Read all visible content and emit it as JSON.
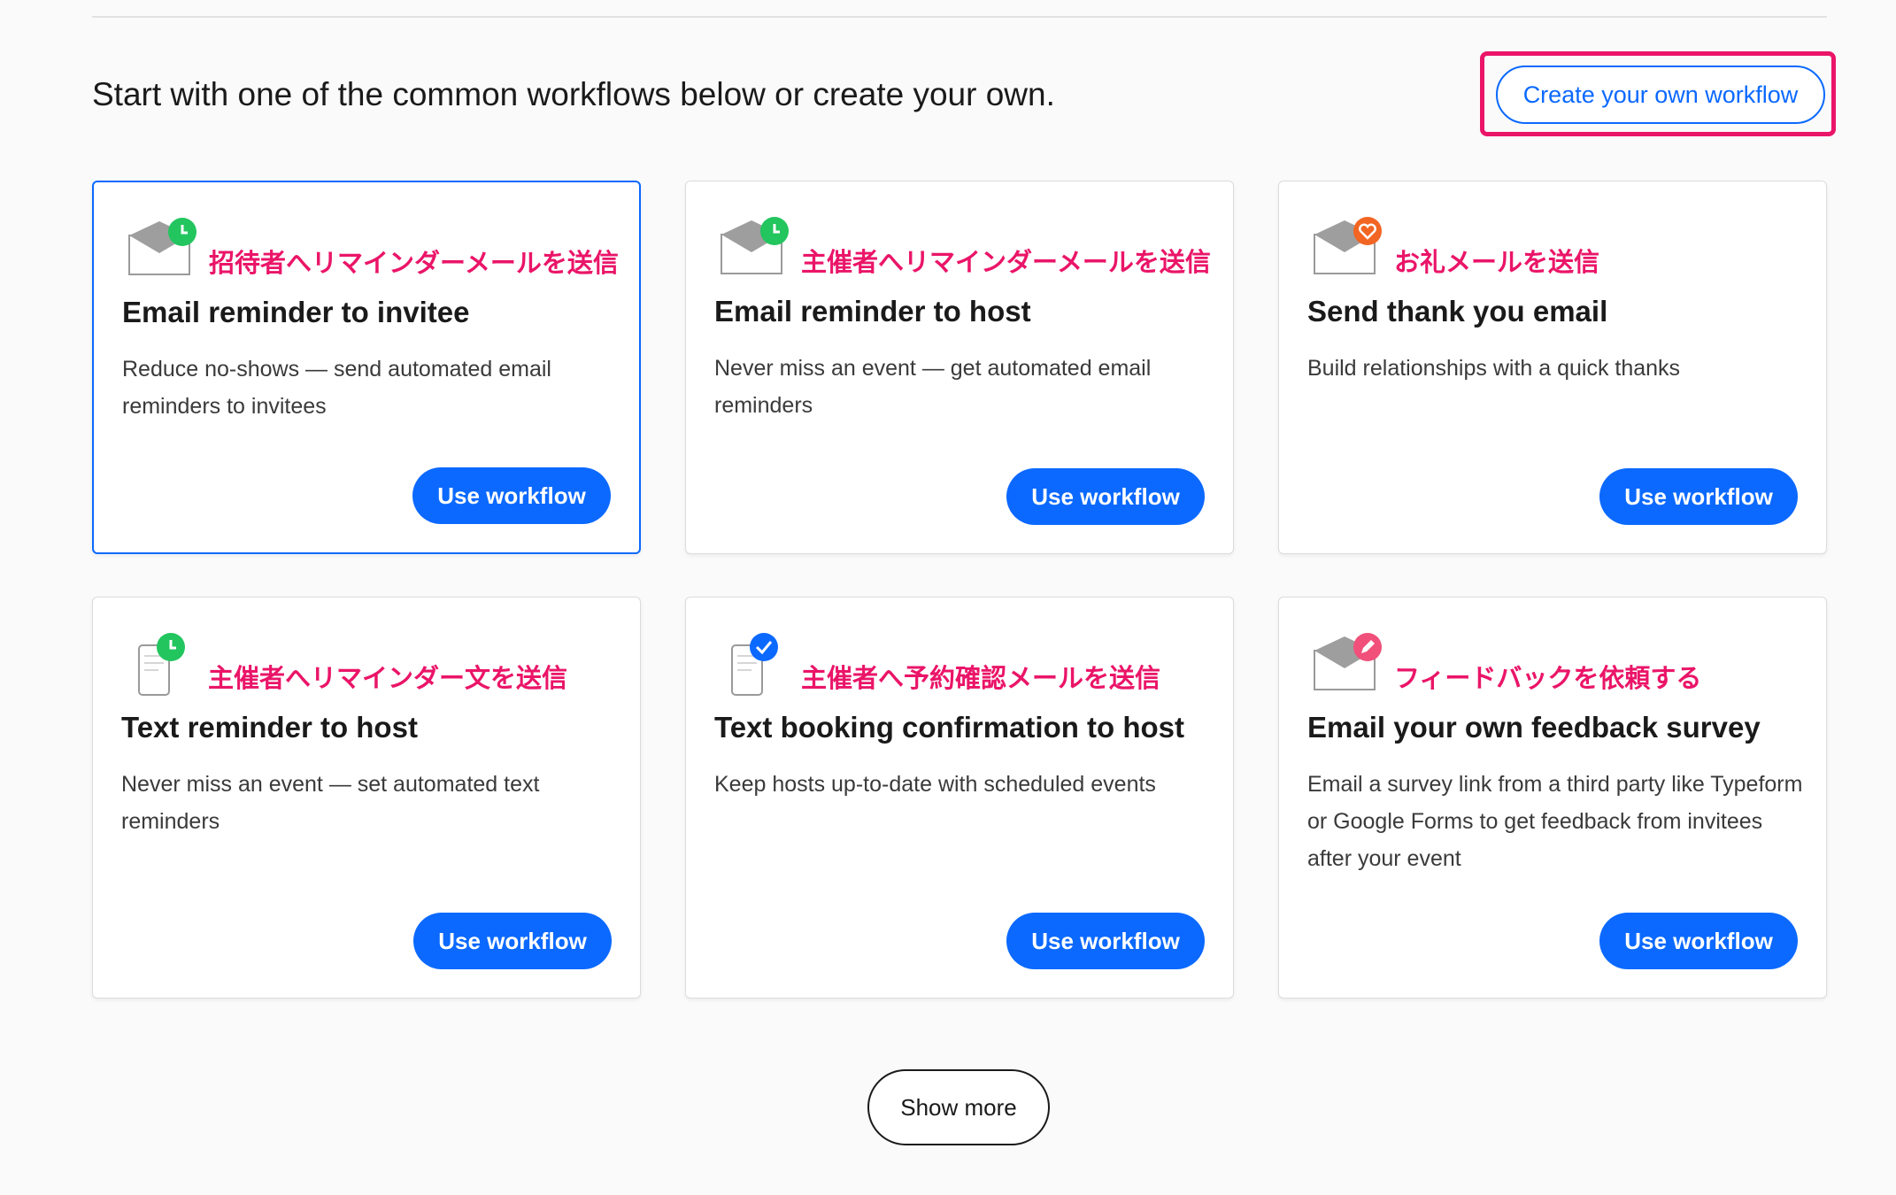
{
  "intro": "Start with one of the common workflows below or create your own.",
  "create_button": "Create your own workflow",
  "show_more": "Show more",
  "colors": {
    "accent": "#0b69ff",
    "annotation": "#ea1568",
    "badge_green": "#22c55e",
    "badge_blue": "#0b69ff",
    "badge_orange": "#f26522",
    "badge_pink": "#f0507a"
  },
  "cards": [
    {
      "jp_label": "招待者へリマインダーメールを送信",
      "title": "Email reminder to invitee",
      "description": "Reduce no-shows — send automated email reminders to invitees",
      "button": "Use workflow",
      "icon": "envelope-clock-icon"
    },
    {
      "jp_label": "主催者へリマインダーメールを送信",
      "title": "Email reminder to host",
      "description": "Never miss an event — get automated email reminders",
      "button": "Use workflow",
      "icon": "envelope-clock-icon"
    },
    {
      "jp_label": "お礼メールを送信",
      "title": "Send thank you email",
      "description": "Build relationships with a quick thanks",
      "button": "Use workflow",
      "icon": "envelope-heart-icon"
    },
    {
      "jp_label": "主催者へリマインダー文を送信",
      "title": "Text reminder to host",
      "description": "Never miss an event — set automated text reminders",
      "button": "Use workflow",
      "icon": "phone-clock-icon"
    },
    {
      "jp_label": "主催者へ予約確認メールを送信",
      "title": "Text booking confirmation to host",
      "description": "Keep hosts up-to-date with scheduled events",
      "button": "Use workflow",
      "icon": "phone-check-icon"
    },
    {
      "jp_label": "フィードバックを依頼する",
      "title": "Email your own feedback survey",
      "description": "Email a survey link from a third party like Typeform or Google Forms to get feedback from invitees after your event",
      "button": "Use workflow",
      "icon": "envelope-pencil-icon"
    }
  ]
}
